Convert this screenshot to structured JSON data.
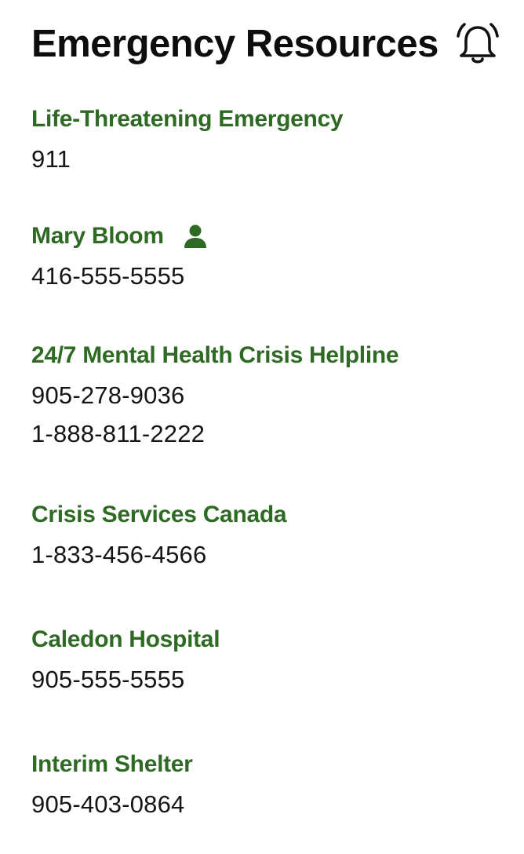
{
  "header": {
    "title": "Emergency Resources",
    "bell_icon": "bell-icon"
  },
  "resources": [
    {
      "name": "Life-Threatening Emergency",
      "phones": [
        "911"
      ]
    },
    {
      "name": "Mary Bloom",
      "icon": "person-icon",
      "phones": [
        "416-555-5555"
      ]
    },
    {
      "name": "24/7 Mental Health Crisis Helpline",
      "phones": [
        "905-278-9036",
        "1-888-811-2222"
      ]
    },
    {
      "name": "Crisis Services Canada",
      "phones": [
        "1-833-456-4566"
      ]
    },
    {
      "name": "Caledon Hospital",
      "phones": [
        "905-555-5555"
      ]
    },
    {
      "name": "Interim Shelter",
      "phones": [
        "905-403-0864"
      ]
    }
  ],
  "colors": {
    "accent_green": "#2f6a25",
    "text": "#151515",
    "background": "#ffffff"
  }
}
